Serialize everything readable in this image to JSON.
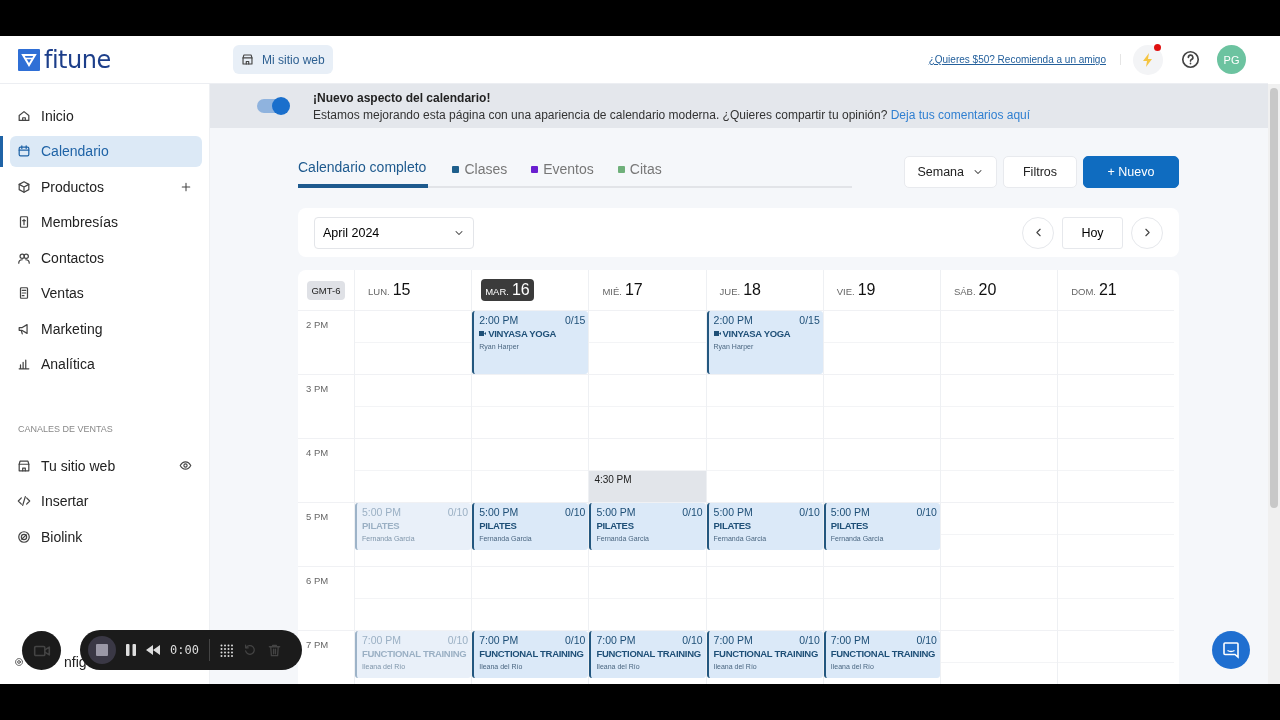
{
  "brand": {
    "name": "fitune"
  },
  "header": {
    "site_button": "Mi sitio web",
    "referral_link": "¿Quieres $50? Recomienda a un amigo",
    "unread": true,
    "avatar": "PG"
  },
  "sidebar": {
    "items": [
      {
        "label": "Inicio",
        "selected": false
      },
      {
        "label": "Calendario",
        "selected": true
      },
      {
        "label": "Productos",
        "selected": false,
        "kind": "addable"
      },
      {
        "label": "Membresías",
        "selected": false
      },
      {
        "label": "Contactos",
        "selected": false
      },
      {
        "label": "Ventas",
        "selected": false
      },
      {
        "label": "Marketing",
        "selected": false
      },
      {
        "label": "Analítica",
        "selected": false
      }
    ],
    "section_title": "CANALES DE VENTAS",
    "channel_items": [
      {
        "label": "Tu sitio web",
        "selected": false,
        "kind": "previewable"
      },
      {
        "label": "Insertar",
        "selected": false
      },
      {
        "label": "Biolink",
        "selected": false
      }
    ],
    "footer_item": "nfig"
  },
  "banner": {
    "toggle_on": true,
    "title": "¡Nuevo aspecto del calendario!",
    "text": "Estamos mejorando esta página con una apariencia de calendario moderna. ¿Quieres compartir tu opinión?",
    "link": "Deja tus comentarios aquí"
  },
  "tabs": [
    {
      "label": "Calendario completo",
      "selected": true
    },
    {
      "label": "Clases",
      "selected": false,
      "color": "#1e5f8c"
    },
    {
      "label": "Eventos",
      "selected": false,
      "color": "#6a1fd0"
    },
    {
      "label": "Citas",
      "selected": false,
      "color": "#6fb07a"
    }
  ],
  "toolbar": {
    "view_select": "Semana",
    "filters_button": "Filtros",
    "new_button": "+ Nuevo"
  },
  "navigator": {
    "month_select": "April 2024",
    "today_button": "Hoy"
  },
  "calendar": {
    "timezone": "GMT-6",
    "days": [
      {
        "weekday": "LUN.",
        "date": "15",
        "selected": false
      },
      {
        "weekday": "MAR.",
        "date": "16",
        "selected": true
      },
      {
        "weekday": "MIÉ.",
        "date": "17",
        "selected": false
      },
      {
        "weekday": "JUE.",
        "date": "18",
        "selected": false
      },
      {
        "weekday": "VIE.",
        "date": "19",
        "selected": false
      },
      {
        "weekday": "SÁB.",
        "date": "20",
        "selected": false
      },
      {
        "weekday": "DOM.",
        "date": "21",
        "selected": false
      }
    ],
    "hours": [
      {
        "label": "2 PM",
        "cells": [
          null,
          {
            "kind": "class",
            "time": "2:00 PM",
            "capacity": "0/15",
            "title": "VINYASA YOGA",
            "instructor": "Ryan Harper",
            "online": true,
            "past": false
          },
          null,
          {
            "kind": "class",
            "time": "2:00 PM",
            "capacity": "0/15",
            "title": "VINYASA YOGA",
            "instructor": "Ryan Harper",
            "online": true,
            "past": false
          },
          null,
          null,
          null
        ]
      },
      {
        "label": "3 PM",
        "cells": [
          null,
          null,
          null,
          null,
          null,
          null,
          null
        ]
      },
      {
        "label": "4 PM",
        "cells": [
          null,
          null,
          {
            "kind": "slot",
            "time": "4:30 PM"
          },
          null,
          null,
          null,
          null
        ]
      },
      {
        "label": "5 PM",
        "cells": [
          {
            "kind": "class",
            "time": "5:00 PM",
            "capacity": "0/10",
            "title": "PILATES",
            "instructor": "Fernanda Garcia",
            "online": false,
            "past": true
          },
          {
            "kind": "class",
            "time": "5:00 PM",
            "capacity": "0/10",
            "title": "PILATES",
            "instructor": "Fernanda Garcia",
            "online": false,
            "past": false
          },
          {
            "kind": "class",
            "time": "5:00 PM",
            "capacity": "0/10",
            "title": "PILATES",
            "instructor": "Fernanda Garcia",
            "online": false,
            "past": false
          },
          {
            "kind": "class",
            "time": "5:00 PM",
            "capacity": "0/10",
            "title": "PILATES",
            "instructor": "Fernanda Garcia",
            "online": false,
            "past": false
          },
          {
            "kind": "class",
            "time": "5:00 PM",
            "capacity": "0/10",
            "title": "PILATES",
            "instructor": "Fernanda Garcia",
            "online": false,
            "past": false
          },
          null,
          null
        ]
      },
      {
        "label": "6 PM",
        "cells": [
          null,
          null,
          null,
          null,
          null,
          null,
          null
        ]
      },
      {
        "label": "7 PM",
        "cells": [
          {
            "kind": "class",
            "time": "7:00 PM",
            "capacity": "0/10",
            "title": "FUNCTIONAL TRAINING",
            "instructor": "Ileana del Río",
            "online": false,
            "past": true
          },
          {
            "kind": "class",
            "time": "7:00 PM",
            "capacity": "0/10",
            "title": "FUNCTIONAL TRAINING",
            "instructor": "Ileana del Río",
            "online": false,
            "past": false
          },
          {
            "kind": "class",
            "time": "7:00 PM",
            "capacity": "0/10",
            "title": "FUNCTIONAL TRAINING",
            "instructor": "Ileana del Río",
            "online": false,
            "past": false
          },
          {
            "kind": "class",
            "time": "7:00 PM",
            "capacity": "0/10",
            "title": "FUNCTIONAL TRAINING",
            "instructor": "Ileana del Río",
            "online": false,
            "past": false
          },
          {
            "kind": "class",
            "time": "7:00 PM",
            "capacity": "0/10",
            "title": "FUNCTIONAL TRAINING",
            "instructor": "Ileana del Río",
            "online": false,
            "past": false
          },
          null,
          null
        ]
      }
    ]
  },
  "recorder": {
    "timer": "0:00"
  }
}
